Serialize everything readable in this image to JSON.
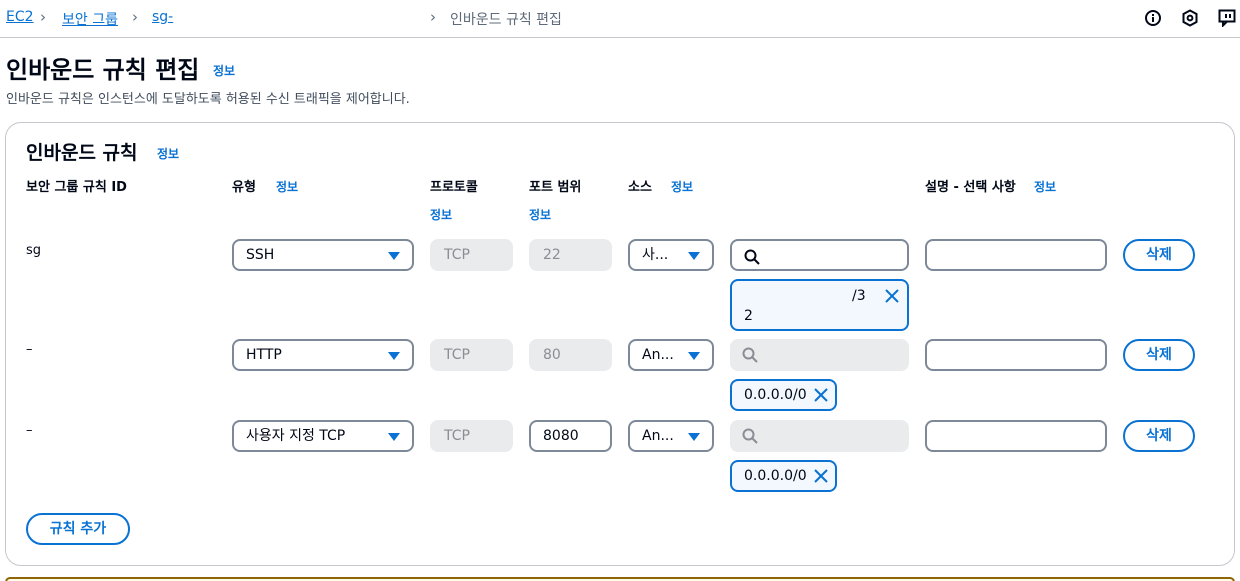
{
  "breadcrumb": {
    "items": [
      "EC2",
      "보안 그룹",
      "sg-"
    ],
    "current": "인바운드 규칙 편집"
  },
  "top_icons": [
    "info-circle-icon",
    "settings-hex-icon",
    "feedback-icon"
  ],
  "page": {
    "title": "인바운드 규칙 편집",
    "info": "정보",
    "description": "인바운드 규칙은 인스턴스에 도달하도록 허용된 수신 트래픽을 제어합니다."
  },
  "panel": {
    "title": "인바운드 규칙",
    "info": "정보"
  },
  "columns": {
    "rule_id": "보안 그룹 규칙 ID",
    "type": "유형",
    "type_info": "정보",
    "protocol": "프로토콜",
    "protocol_info": "정보",
    "port": "포트 범위",
    "port_info": "정보",
    "source": "소스",
    "source_info": "정보",
    "description": "설명 - 선택 사항",
    "description_info": "정보"
  },
  "rules": [
    {
      "rule_id": "sg",
      "type": "SSH",
      "protocol": "TCP",
      "port": "22",
      "source": "사...",
      "token": "/3",
      "token_line2": "2",
      "description": "",
      "delete": "삭제"
    },
    {
      "rule_id": "–",
      "type": "HTTP",
      "protocol": "TCP",
      "port": "80",
      "source": "An...",
      "token": "0.0.0.0/0",
      "description": "",
      "delete": "삭제"
    },
    {
      "rule_id": "–",
      "type": "사용자 지정 TCP",
      "protocol": "TCP",
      "port": "8080",
      "source": "An...",
      "token": "0.0.0.0/0",
      "description": "",
      "delete": "삭제"
    }
  ],
  "add_rule": "규칙 추가",
  "colors": {
    "accent": "#0972d3",
    "border": "#7d8998",
    "disabled_bg": "#e9ebed",
    "warning_border": "#8d6605"
  }
}
